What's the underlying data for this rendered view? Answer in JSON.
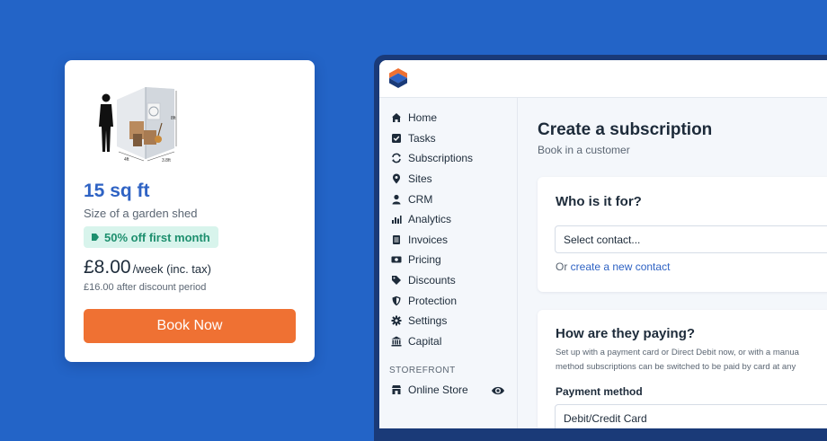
{
  "unit_card": {
    "size": "15 sq ft",
    "description": "Size of a garden shed",
    "promo": "50% off first month",
    "price": "£8.00",
    "price_unit": "/week (inc. tax)",
    "price_after": "£16.00 after discount period",
    "book_label": "Book Now",
    "dimensions": {
      "height": "8ft",
      "width": "4ft",
      "depth": "3.8ft"
    }
  },
  "sidebar": {
    "items": [
      {
        "label": "Home",
        "icon": "home-icon"
      },
      {
        "label": "Tasks",
        "icon": "checkbox-icon"
      },
      {
        "label": "Subscriptions",
        "icon": "refresh-icon"
      },
      {
        "label": "Sites",
        "icon": "map-pin-icon"
      },
      {
        "label": "CRM",
        "icon": "user-icon"
      },
      {
        "label": "Analytics",
        "icon": "bar-chart-icon"
      },
      {
        "label": "Invoices",
        "icon": "invoice-icon"
      },
      {
        "label": "Pricing",
        "icon": "money-icon"
      },
      {
        "label": "Discounts",
        "icon": "tag-icon"
      },
      {
        "label": "Protection",
        "icon": "shield-icon"
      },
      {
        "label": "Settings",
        "icon": "gear-icon"
      },
      {
        "label": "Capital",
        "icon": "bank-icon"
      }
    ],
    "storefront_heading": "STOREFRONT",
    "online_store": {
      "label": "Online Store",
      "icon": "store-icon"
    }
  },
  "main": {
    "title": "Create a subscription",
    "subtitle": "Book in a customer",
    "who_panel": {
      "title": "Who is it for?",
      "select_value": "Select contact...",
      "or_text": "Or ",
      "create_link": "create a new contact"
    },
    "pay_panel": {
      "title": "How are they paying?",
      "desc_line1": "Set up with a payment card or Direct Debit now, or with a manua",
      "desc_line2": "method subscriptions can be switched to be paid by card at any",
      "field_label": "Payment method",
      "field_value": "Debit/Credit Card"
    }
  },
  "colors": {
    "background": "#2364c7",
    "accent": "#2f63c4",
    "button": "#ef7133",
    "promo_bg": "#d8f4ec",
    "promo_text": "#1d8f6e"
  }
}
